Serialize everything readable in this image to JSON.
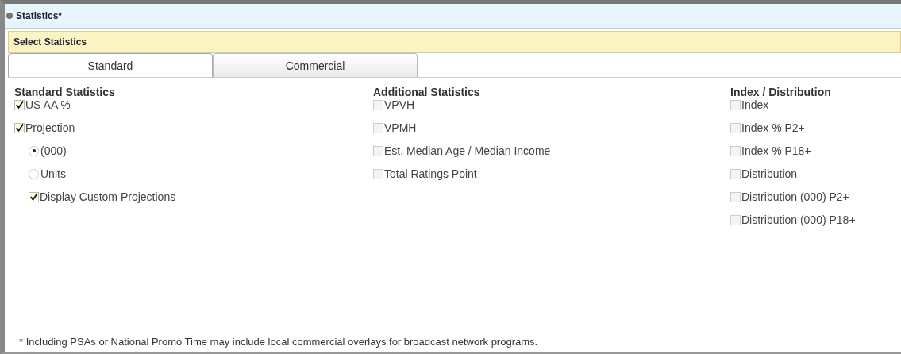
{
  "window": {
    "title": "Statistics*"
  },
  "section": {
    "title": "Select Statistics"
  },
  "tabs": [
    {
      "label": "Standard",
      "selected": true
    },
    {
      "label": "Commercial",
      "selected": false
    }
  ],
  "columns": [
    {
      "heading": "Standard Statistics",
      "items": [
        {
          "kind": "checkbox",
          "label": "US AA %",
          "checked": true
        },
        {
          "kind": "checkbox",
          "label": "Projection",
          "checked": true,
          "children": [
            {
              "kind": "radio",
              "label": "(000)",
              "selected": true
            },
            {
              "kind": "radio",
              "label": "Units",
              "selected": false
            },
            {
              "kind": "checkbox",
              "label": "Display Custom Projections",
              "checked": true
            }
          ]
        }
      ]
    },
    {
      "heading": "Additional Statistics",
      "items": [
        {
          "kind": "checkbox",
          "label": "VPVH",
          "checked": false
        },
        {
          "kind": "checkbox",
          "label": "VPMH",
          "checked": false
        },
        {
          "kind": "checkbox",
          "label": "Est. Median Age / Median Income",
          "checked": false
        },
        {
          "kind": "checkbox",
          "label": "Total Ratings Point",
          "checked": false
        }
      ]
    },
    {
      "heading": "Index / Distribution",
      "items": [
        {
          "kind": "checkbox",
          "label": "Index",
          "checked": false
        },
        {
          "kind": "checkbox",
          "label": "Index % P2+",
          "checked": false
        },
        {
          "kind": "checkbox",
          "label": "Index % P18+",
          "checked": false
        },
        {
          "kind": "checkbox",
          "label": "Distribution",
          "checked": false
        },
        {
          "kind": "checkbox",
          "label": "Distribution (000) P2+",
          "checked": false
        },
        {
          "kind": "checkbox",
          "label": "Distribution (000) P18+",
          "checked": false
        }
      ]
    }
  ],
  "footnote": "* Including PSAs or National Promo Time may include local commercial overlays for broadcast network programs."
}
